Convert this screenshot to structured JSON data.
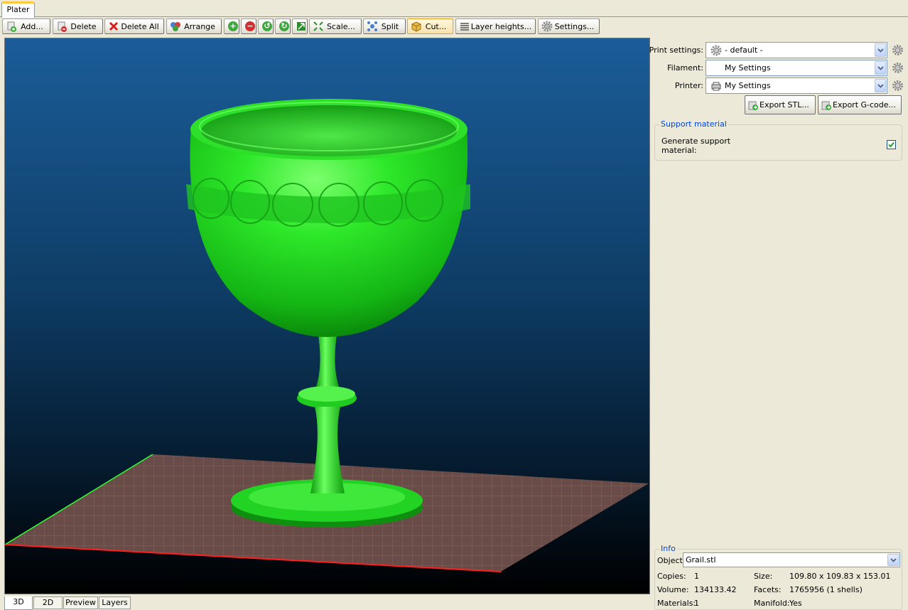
{
  "tabs": {
    "plater": "Plater"
  },
  "toolbar": {
    "add": "Add...",
    "delete": "Delete",
    "delete_all": "Delete All",
    "arrange": "Arrange",
    "scale": "Scale...",
    "split": "Split",
    "cut": "Cut...",
    "layer_heights": "Layer heights...",
    "settings": "Settings..."
  },
  "view_tabs": [
    "3D",
    "2D",
    "Preview",
    "Layers"
  ],
  "presets": {
    "print_label": "Print settings:",
    "print_value": "- default -",
    "filament_label": "Filament:",
    "filament_value": "My Settings",
    "printer_label": "Printer:",
    "printer_value": "My Settings"
  },
  "export": {
    "stl": "Export STL...",
    "gcode": "Export G-code..."
  },
  "support": {
    "title": "Support material",
    "generate_label_line1": "Generate support",
    "generate_label_line2": "material:",
    "generate_checked": true
  },
  "info": {
    "title": "Info",
    "object_label": "Object:",
    "object_value": "Grail.stl",
    "copies_label": "Copies:",
    "copies_value": "1",
    "size_label": "Size:",
    "size_value": "109.80 x 109.83 x 153.01",
    "volume_label": "Volume:",
    "volume_value": "134133.42",
    "facets_label": "Facets:",
    "facets_value": "1765956 (1 shells)",
    "materials_label": "Materials:",
    "materials_value": "1",
    "manifold_label": "Manifold:",
    "manifold_value": "Yes"
  },
  "colors": {
    "object": "#22dd22",
    "bed": "#6e4f4a",
    "x_axis": "#ff2020",
    "y_axis": "#30ff30",
    "tab_accent": "#ffc83c",
    "group_title": "#0046d5"
  }
}
